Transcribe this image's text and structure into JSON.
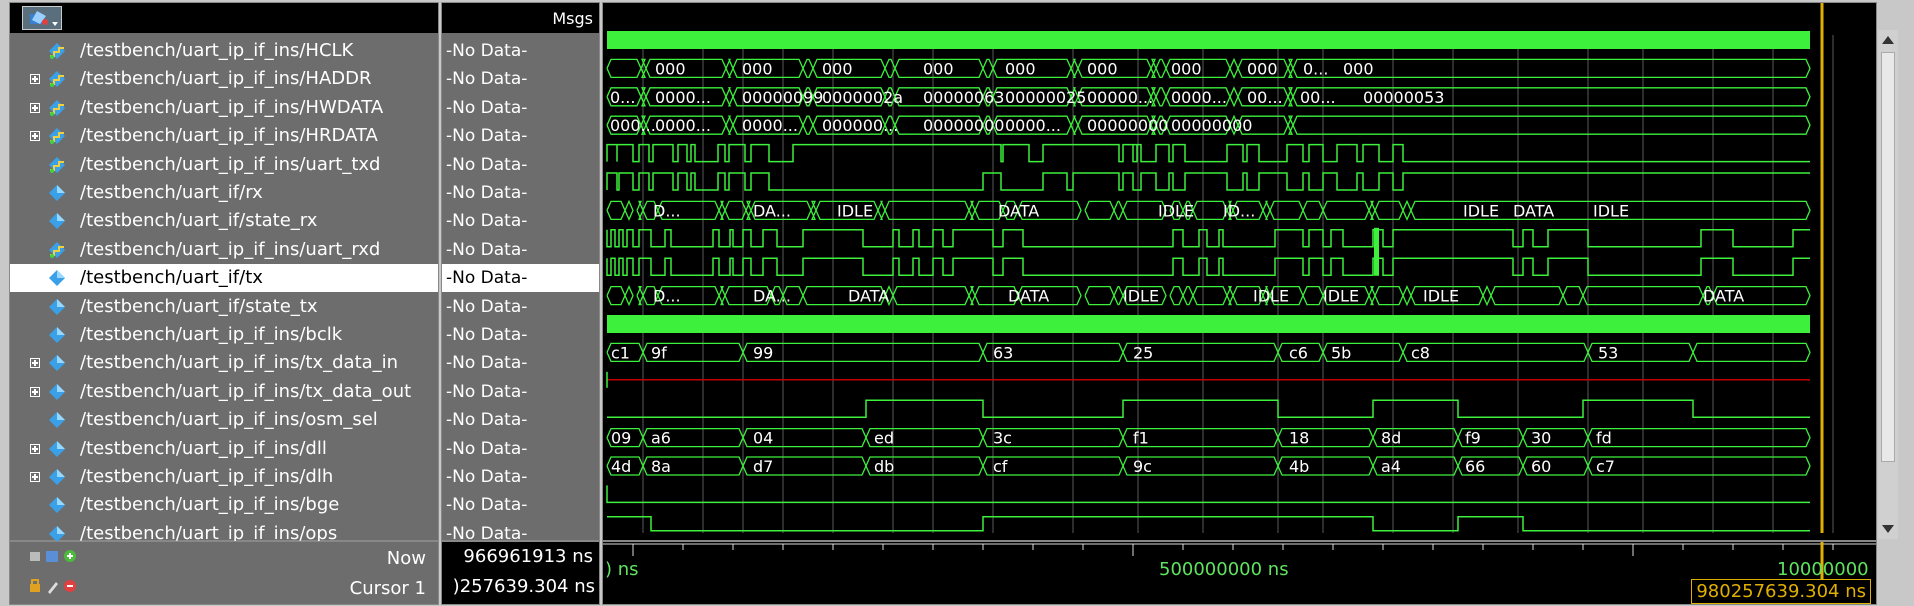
{
  "toolbar": {
    "icon": "signal-tool-icon"
  },
  "header": {
    "msgs_label": "Msgs"
  },
  "signals": [
    {
      "name": "/testbench/uart_ip_if_ins/HCLK",
      "msg": "-No Data-",
      "expandable": false,
      "icon": "wave-signal-icon"
    },
    {
      "name": "/testbench/uart_ip_if_ins/HADDR",
      "msg": "-No Data-",
      "expandable": true,
      "icon": "wave-signal-icon"
    },
    {
      "name": "/testbench/uart_ip_if_ins/HWDATA",
      "msg": "-No Data-",
      "expandable": true,
      "icon": "wave-signal-icon"
    },
    {
      "name": "/testbench/uart_ip_if_ins/HRDATA",
      "msg": "-No Data-",
      "expandable": true,
      "icon": "wave-signal-icon"
    },
    {
      "name": "/testbench/uart_ip_if_ins/uart_txd",
      "msg": "-No Data-",
      "expandable": false,
      "icon": "wave-signal-icon"
    },
    {
      "name": "/testbench/uart_if/rx",
      "msg": "-No Data-",
      "expandable": false,
      "icon": "diamond-signal-icon"
    },
    {
      "name": "/testbench/uart_if/state_rx",
      "msg": "-No Data-",
      "expandable": false,
      "icon": "diamond-signal-icon"
    },
    {
      "name": "/testbench/uart_ip_if_ins/uart_rxd",
      "msg": "-No Data-",
      "expandable": false,
      "icon": "wave-signal-icon"
    },
    {
      "name": "/testbench/uart_if/tx",
      "msg": "-No Data-",
      "expandable": false,
      "icon": "diamond-signal-icon",
      "selected": true
    },
    {
      "name": "/testbench/uart_if/state_tx",
      "msg": "-No Data-",
      "expandable": false,
      "icon": "diamond-signal-icon"
    },
    {
      "name": "/testbench/uart_ip_if_ins/bclk",
      "msg": "-No Data-",
      "expandable": false,
      "icon": "diamond-signal-icon"
    },
    {
      "name": "/testbench/uart_ip_if_ins/tx_data_in",
      "msg": "-No Data-",
      "expandable": true,
      "icon": "diamond-signal-icon"
    },
    {
      "name": "/testbench/uart_ip_if_ins/tx_data_out",
      "msg": "-No Data-",
      "expandable": true,
      "icon": "diamond-signal-icon"
    },
    {
      "name": "/testbench/uart_ip_if_ins/osm_sel",
      "msg": "-No Data-",
      "expandable": false,
      "icon": "diamond-signal-icon"
    },
    {
      "name": "/testbench/uart_ip_if_ins/dll",
      "msg": "-No Data-",
      "expandable": true,
      "icon": "diamond-signal-icon"
    },
    {
      "name": "/testbench/uart_ip_if_ins/dlh",
      "msg": "-No Data-",
      "expandable": true,
      "icon": "diamond-signal-icon"
    },
    {
      "name": "/testbench/uart_ip_if_ins/bge",
      "msg": "-No Data-",
      "expandable": false,
      "icon": "diamond-signal-icon"
    },
    {
      "name": "/testbench/uart_ip_if_ins/ops",
      "msg": "-No Data-",
      "expandable": false,
      "icon": "diamond-signal-icon"
    }
  ],
  "bus_values": {
    "HADDR": [
      "000",
      "000",
      "000",
      "000",
      "000",
      "000",
      "000",
      "000",
      "0...",
      "000"
    ],
    "HWDATA": [
      "0...",
      "0000...",
      "00000099",
      "0000002a",
      "00000063",
      "00000025",
      "00000...",
      "0000...",
      "00...",
      "00...",
      "00000053"
    ],
    "HRDATA": [
      "000...",
      "0000...",
      "0000...",
      "000000...",
      "00000000",
      "0000...",
      "00000000",
      "00000000"
    ],
    "state_rx": [
      "D...",
      "DA...",
      "IDLE",
      "DATA",
      "IDLE",
      "ID...",
      "IDLE",
      "DATA",
      "IDLE"
    ],
    "state_tx": [
      "D...",
      "DA...",
      "DATA",
      "DATA",
      "IDLE",
      "IDLE",
      "IDLE",
      "IDLE",
      "DATA"
    ],
    "tx_data_in": [
      "c1",
      "9f",
      "99",
      "63",
      "25",
      "c6",
      "5b",
      "c8",
      "53"
    ],
    "dll": [
      "09",
      "a6",
      "04",
      "ed",
      "3c",
      "f1",
      "18",
      "8d",
      "f9",
      "30",
      "fd"
    ],
    "dlh": [
      "4d",
      "8a",
      "d7",
      "db",
      "cf",
      "9c",
      "4b",
      "a4",
      "66",
      "60",
      "c7"
    ]
  },
  "timeline": {
    "start_label": ") ns",
    "mid_label": "500000000 ns",
    "end_label": "10000000",
    "now_label": "Now",
    "now_value": "966961913 ns",
    "cursor_label": "Cursor 1",
    "cursor_value": ")257639.304 ns",
    "cursor_box": "980257639.304 ns"
  },
  "colors": {
    "wave": "#3cf03c",
    "cursor": "#e0b000",
    "undefined": "#c00000"
  }
}
